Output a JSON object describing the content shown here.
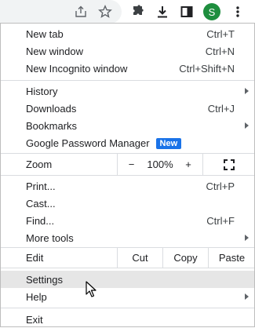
{
  "toolbar": {
    "icons": [
      "share-icon",
      "star-icon",
      "extensions-icon",
      "download-icon",
      "side-panel-icon",
      "profile-avatar",
      "more-menu-icon"
    ],
    "avatar_letter": "S"
  },
  "menu": {
    "new_tab": {
      "label": "New tab",
      "shortcut": "Ctrl+T"
    },
    "new_window": {
      "label": "New window",
      "shortcut": "Ctrl+N"
    },
    "new_incognito": {
      "label": "New Incognito window",
      "shortcut": "Ctrl+Shift+N"
    },
    "history": {
      "label": "History"
    },
    "downloads": {
      "label": "Downloads",
      "shortcut": "Ctrl+J"
    },
    "bookmarks": {
      "label": "Bookmarks"
    },
    "password_manager": {
      "label": "Google Password Manager",
      "badge": "New"
    },
    "zoom": {
      "label": "Zoom",
      "minus": "−",
      "value": "100%",
      "plus": "+"
    },
    "print": {
      "label": "Print...",
      "shortcut": "Ctrl+P"
    },
    "cast": {
      "label": "Cast..."
    },
    "find": {
      "label": "Find...",
      "shortcut": "Ctrl+F"
    },
    "more_tools": {
      "label": "More tools"
    },
    "edit": {
      "label": "Edit",
      "cut": "Cut",
      "copy": "Copy",
      "paste": "Paste"
    },
    "settings": {
      "label": "Settings"
    },
    "help": {
      "label": "Help"
    },
    "exit": {
      "label": "Exit"
    }
  },
  "colors": {
    "badge": "#1a73e8",
    "avatar": "#1e8e3e",
    "hover": "#e6e6e6"
  }
}
